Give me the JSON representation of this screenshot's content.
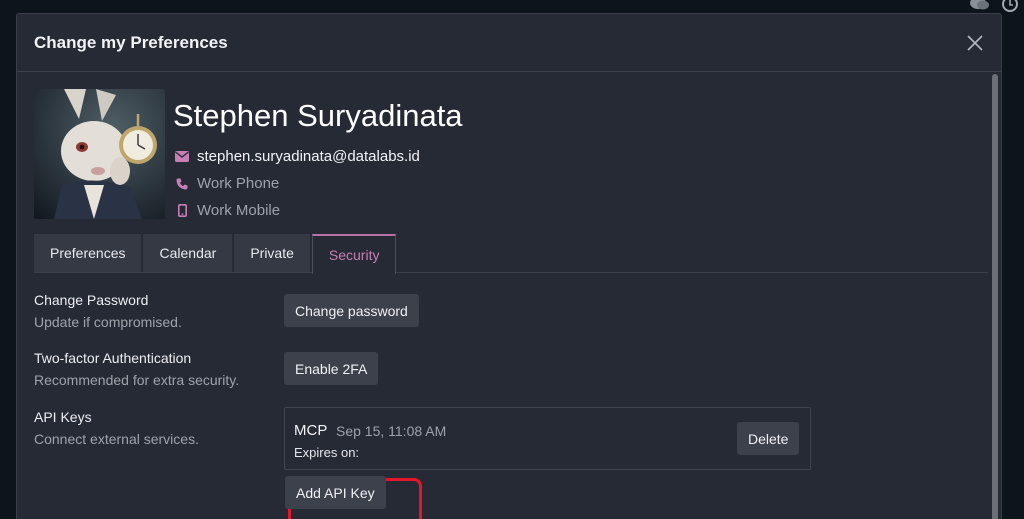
{
  "dialog": {
    "title": "Change my Preferences"
  },
  "profile": {
    "name": "Stephen Suryadinata",
    "email": "stephen.suryadinata@datalabs.id",
    "work_phone": "Work Phone",
    "work_mobile": "Work Mobile"
  },
  "tabs": [
    {
      "label": "Preferences",
      "active": false
    },
    {
      "label": "Calendar",
      "active": false
    },
    {
      "label": "Private",
      "active": false
    },
    {
      "label": "Security",
      "active": true
    }
  ],
  "security": {
    "change_password": {
      "label": "Change Password",
      "description": "Update if compromised.",
      "button": "Change password"
    },
    "two_factor": {
      "label": "Two-factor Authentication",
      "description": "Recommended for extra security.",
      "button": "Enable 2FA"
    },
    "api_keys": {
      "label": "API Keys",
      "description": "Connect external services.",
      "items": [
        {
          "name": "MCP",
          "created": "Sep 15, 11:08 AM",
          "expires_label": "Expires on:",
          "delete_label": "Delete"
        }
      ],
      "add_button": "Add API Key"
    }
  },
  "colors": {
    "accent": "#c77fb6",
    "highlight": "#e5162b",
    "background": "#262a35"
  },
  "icons": [
    "comments-icon",
    "clock-icon",
    "close-icon",
    "envelope-icon",
    "phone-icon",
    "mobile-icon"
  ]
}
